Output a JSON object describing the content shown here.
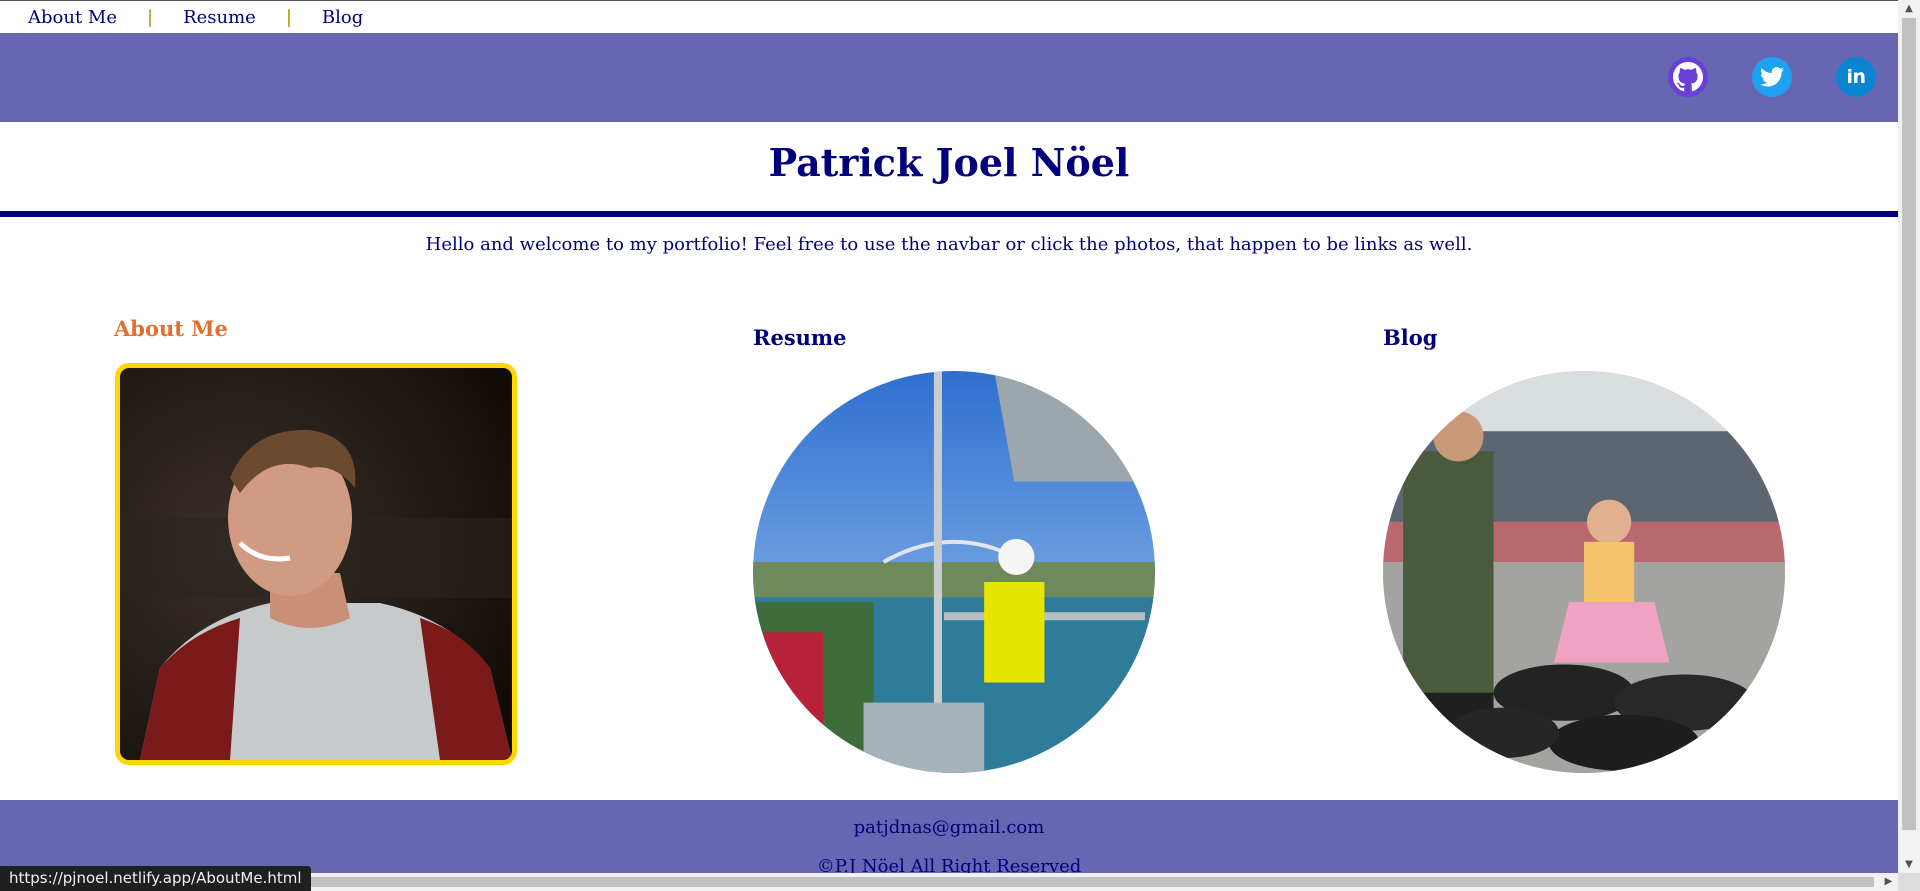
{
  "nav": {
    "items": [
      "About Me",
      "Resume",
      "Blog"
    ],
    "separator": "|"
  },
  "social": {
    "icons": [
      "github-icon",
      "twitter-icon",
      "linkedin-icon"
    ],
    "linkedin_text": "in"
  },
  "header": {
    "title": "Patrick Joel Nöel"
  },
  "intro": {
    "welcome": "Hello and welcome to my portfolio! Feel free to use the navbar or click the photos, that happen to be links as well."
  },
  "cards": [
    {
      "title": "About Me",
      "color": "#e07030"
    },
    {
      "title": "Resume",
      "color": "#00007a"
    },
    {
      "title": "Blog",
      "color": "#00007a"
    }
  ],
  "footer": {
    "email": "patjdnas@gmail.com",
    "copyright": "©P.J Nöel All Right Reserved"
  },
  "status": {
    "url": "https://pjnoel.netlify.app/AboutMe.html"
  },
  "colors": {
    "banner": "#6666b3",
    "primary": "#00007a",
    "accent_border": "#ffd700"
  }
}
